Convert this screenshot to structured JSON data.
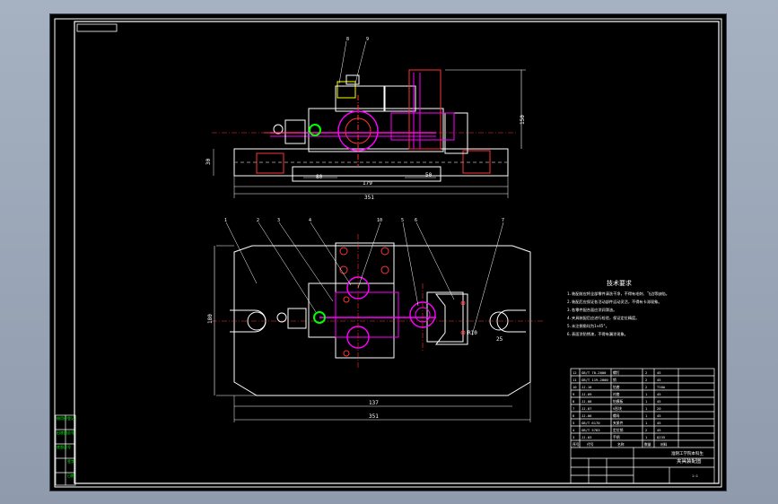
{
  "drawing": {
    "title_sheet": "夹具装配图",
    "university": "淮阴工学院本科生",
    "tech_req_title": "技术要求",
    "tech_req_lines": [
      "1.装配前应将全部零件清洗干净，不得有毛刺、飞边等缺陷。",
      "2.装配后应保证各活动部件运动灵活，不得有卡滞现象。",
      "3.各零件配合面应涂润滑油。",
      "4.夹具装配后应进行检验，保证定位精度。",
      "5.未注倒角均为1×45°。",
      "6.表面涂防锈漆，不得有漏涂现象。"
    ],
    "dims_front": {
      "height": "150",
      "left": "30",
      "inner1": "80",
      "inner2": "50",
      "span": "179",
      "overall": "351"
    },
    "dims_top": {
      "depth": "180",
      "mid": "137",
      "overall": "351",
      "r": "R10",
      "side": "25"
    },
    "balloons": [
      "1",
      "2",
      "3",
      "4",
      "10",
      "5",
      "6",
      "7"
    ],
    "balloons_front": [
      "8",
      "9"
    ],
    "title_block_rows": [
      [
        "12",
        "GB/T 70-2000",
        "螺钉",
        "2",
        "45"
      ],
      [
        "11",
        "GB/T 119-2000",
        "销",
        "2",
        "45"
      ],
      [
        "10",
        "JJ-10",
        "钻套",
        "2",
        "T10A"
      ],
      [
        "9",
        "JJ-09",
        "衬套",
        "1",
        "45"
      ],
      [
        "8",
        "JJ-08",
        "钻模板",
        "1",
        "45"
      ],
      [
        "7",
        "JJ-07",
        "V形块",
        "1",
        "20"
      ],
      [
        "6",
        "JJ-06",
        "螺母",
        "1",
        "45"
      ],
      [
        "5",
        "GB/T 6170",
        "夹紧件",
        "1",
        "45"
      ],
      [
        "4",
        "GB/T 5783",
        "定位销",
        "2",
        "45"
      ],
      [
        "3",
        "JJ-03",
        "手柄",
        "1",
        "Q235"
      ]
    ],
    "title_block_header": [
      "序号",
      "代号",
      "名称",
      "数量",
      "材料"
    ],
    "scale": "1:1",
    "left_stamp": [
      "借用件登记",
      "旧底图总号",
      "底图总号",
      "签字",
      "日期"
    ]
  }
}
